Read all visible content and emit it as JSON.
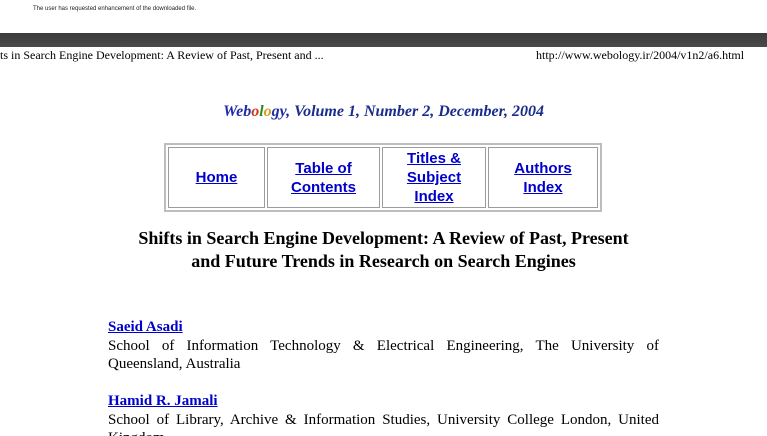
{
  "notice": "The user has requested enhancement of the downloaded file.",
  "header": {
    "title": "ts in Search Engine Development: A Review of Past, Present and ...",
    "url": "http://www.webology.ir/2004/v1n2/a6.html"
  },
  "masthead": {
    "brand_parts": [
      "Web",
      "o",
      "l",
      "o",
      "gy"
    ],
    "rest": ", Volume 1, Number 2, December, 2004"
  },
  "nav": [
    {
      "label_lines": [
        "Home"
      ]
    },
    {
      "label_lines": [
        "Table of",
        "Contents"
      ]
    },
    {
      "label_lines": [
        "Titles &",
        "Subject",
        "Index"
      ]
    },
    {
      "label_lines": [
        "Authors",
        "Index"
      ]
    }
  ],
  "article": {
    "title_line1": "Shifts in Search Engine Development: A Review of Past, Present",
    "title_line2": "and Future Trends in Research on Search Engines"
  },
  "authors": [
    {
      "name": "Saeid Asadi",
      "affiliation": "School of Information Technology & Electrical Engineering, The University of Queensland, Australia"
    },
    {
      "name": "Hamid R. Jamali",
      "affiliation": "School of Library, Archive & Information Studies, University College London, United Kingdom"
    }
  ],
  "colors": {
    "link": "#0000cc",
    "masthead": "#1a2d8c",
    "topbar": "#404040"
  }
}
